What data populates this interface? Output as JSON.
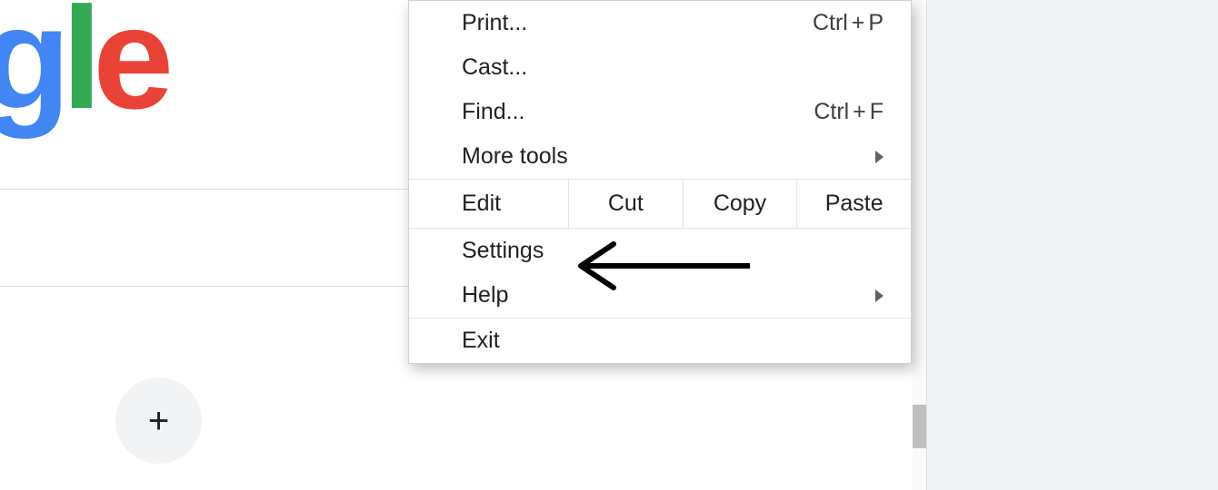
{
  "logo": {
    "g": "g",
    "l": "l",
    "e": "e"
  },
  "shortcut_add_glyph": "+",
  "menu": {
    "print": {
      "label": "Print...",
      "shortcut": "Ctrl + P"
    },
    "cast": {
      "label": "Cast..."
    },
    "find": {
      "label": "Find...",
      "shortcut": "Ctrl + F"
    },
    "more_tools": {
      "label": "More tools"
    },
    "edit": {
      "label": "Edit",
      "cut": "Cut",
      "copy": "Copy",
      "paste": "Paste"
    },
    "settings": {
      "label": "Settings"
    },
    "help": {
      "label": "Help"
    },
    "exit": {
      "label": "Exit"
    }
  }
}
